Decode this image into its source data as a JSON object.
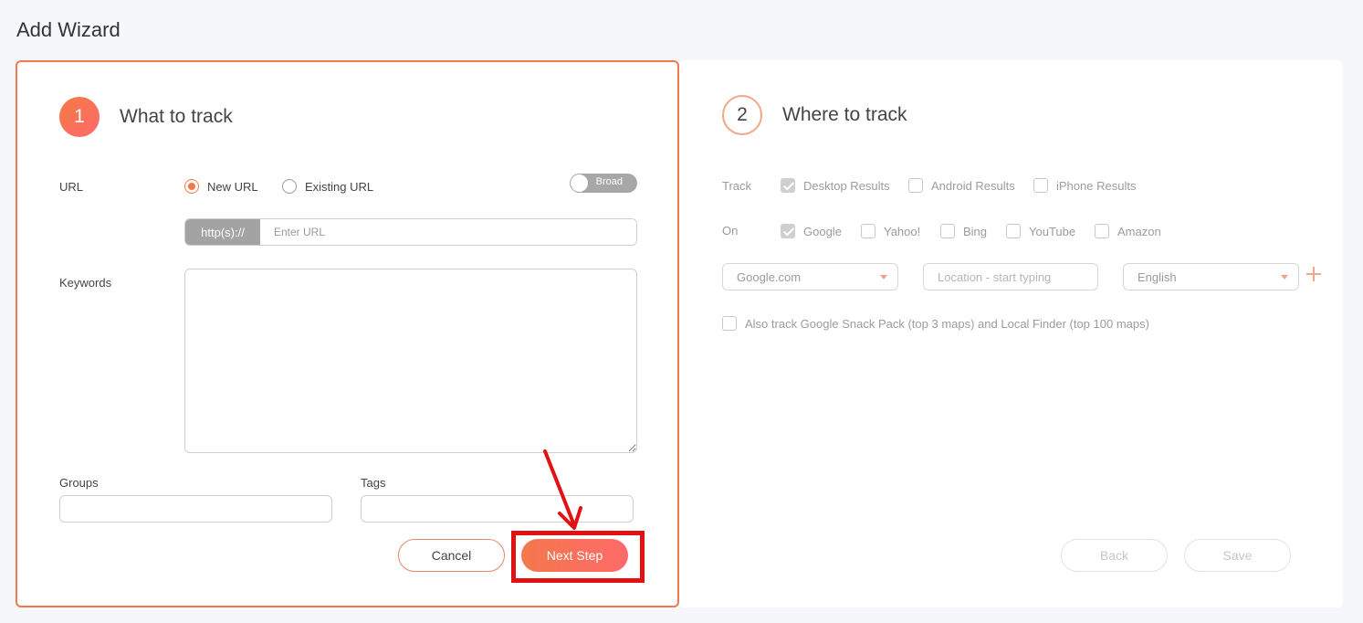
{
  "page": {
    "title": "Add Wizard"
  },
  "step1": {
    "number": "1",
    "title": "What to track",
    "url_label": "URL",
    "radios": {
      "new_url": "New URL",
      "existing_url": "Existing URL",
      "selected": "new_url"
    },
    "toggle_label": "Broad",
    "url_prefix": "http(s)://",
    "url_placeholder": "Enter URL",
    "keywords_label": "Keywords",
    "groups_label": "Groups",
    "tags_label": "Tags",
    "cancel_label": "Cancel",
    "next_label": "Next Step"
  },
  "step2": {
    "number": "2",
    "title": "Where to track",
    "track_label": "Track",
    "track_options": [
      {
        "label": "Desktop Results",
        "checked": true
      },
      {
        "label": "Android Results",
        "checked": false
      },
      {
        "label": "iPhone Results",
        "checked": false
      }
    ],
    "on_label": "On",
    "on_options": [
      {
        "label": "Google",
        "checked": true
      },
      {
        "label": "Yahoo!",
        "checked": false
      },
      {
        "label": "Bing",
        "checked": false
      },
      {
        "label": "YouTube",
        "checked": false
      },
      {
        "label": "Amazon",
        "checked": false
      }
    ],
    "search_engine": "Google.com",
    "location_placeholder": "Location - start typing",
    "language": "English",
    "snack_pack_label": "Also track Google Snack Pack (top 3 maps) and Local Finder (top 100 maps)",
    "back_label": "Back",
    "save_label": "Save"
  },
  "colors": {
    "accent": "#f2784b",
    "highlight": "#e31212"
  }
}
